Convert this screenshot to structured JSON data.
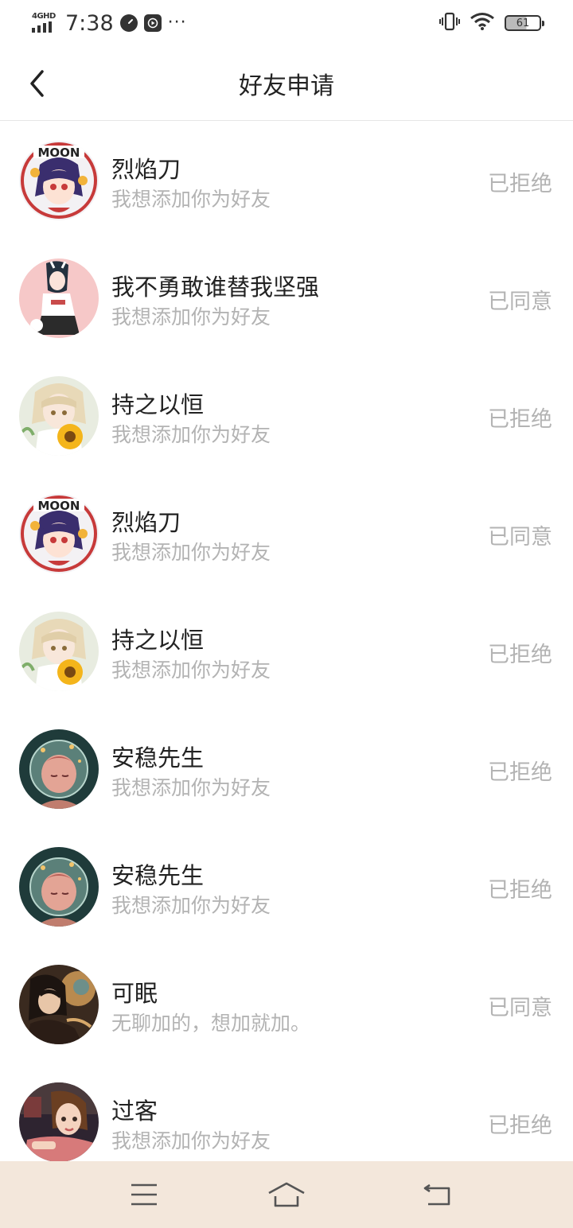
{
  "status_bar": {
    "network": "4GHD",
    "time": "7:38",
    "dots": "···",
    "battery": "61"
  },
  "header": {
    "title": "好友申请"
  },
  "requests": [
    {
      "name": "烈焰刀",
      "message": "我想添加你为好友",
      "status": "已拒绝",
      "avatar": "moon-girl"
    },
    {
      "name": "我不勇敢谁替我坚强",
      "message": "我想添加你为好友",
      "status": "已同意",
      "avatar": "pink-girl"
    },
    {
      "name": "持之以恒",
      "message": "我想添加你为好友",
      "status": "已拒绝",
      "avatar": "sunflower-girl"
    },
    {
      "name": "烈焰刀",
      "message": "我想添加你为好友",
      "status": "已同意",
      "avatar": "moon-girl"
    },
    {
      "name": "持之以恒",
      "message": "我想添加你为好友",
      "status": "已拒绝",
      "avatar": "sunflower-girl"
    },
    {
      "name": "安稳先生",
      "message": "我想添加你为好友",
      "status": "已拒绝",
      "avatar": "sleeping-girl"
    },
    {
      "name": "安稳先生",
      "message": "我想添加你为好友",
      "status": "已拒绝",
      "avatar": "sleeping-girl"
    },
    {
      "name": "可眠",
      "message": "无聊加的，想加就加。",
      "status": "已同意",
      "avatar": "dark-boy"
    },
    {
      "name": "过客",
      "message": "我想添加你为好友",
      "status": "已拒绝",
      "avatar": "cartoon-girl"
    }
  ],
  "colors": {
    "text_primary": "#222222",
    "text_secondary": "#b3b3b3",
    "nav_bg": "#f3e7db",
    "divider": "#e6e6e6"
  },
  "icons": {
    "back": "chevron-left-icon",
    "menu": "menu-icon",
    "home": "home-icon",
    "return": "return-icon"
  }
}
